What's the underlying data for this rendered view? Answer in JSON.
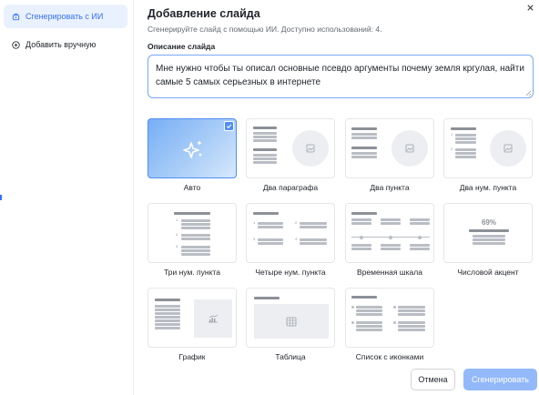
{
  "sidebar": {
    "items": [
      {
        "label": "Сгенерировать с ИИ",
        "icon": "magic-wand-icon",
        "active": true
      },
      {
        "label": "Добавить вручную",
        "icon": "plus-circle-icon",
        "active": false
      }
    ]
  },
  "dialog": {
    "title": "Добавление слайда",
    "subtitle": "Сгенерируйте слайд с помощью ИИ. Доступно использований: 4.",
    "field_label": "Описание слайда",
    "description_value": "Мне нужно чтобы ты описал основные псевдо аргументы почему земля кргулая, найти самые 5 самых серьезных в интернете"
  },
  "layouts": [
    {
      "label": "Авто",
      "selected": true,
      "icon": "sparkles-icon"
    },
    {
      "label": "Два параграфа",
      "selected": false
    },
    {
      "label": "Два пункта",
      "selected": false
    },
    {
      "label": "Два нум. пункта",
      "selected": false
    },
    {
      "label": "Три нум. пункта",
      "selected": false
    },
    {
      "label": "Четыре нум. пункта",
      "selected": false
    },
    {
      "label": "Временная шкала",
      "selected": false
    },
    {
      "label": "Числовой акцент",
      "selected": false,
      "accent_value": "69%"
    },
    {
      "label": "График",
      "selected": false
    },
    {
      "label": "Таблица",
      "selected": false
    },
    {
      "label": "Список с иконками",
      "selected": false
    }
  ],
  "buttons": {
    "cancel": "Отмена",
    "generate": "Сгенерировать"
  },
  "colors": {
    "accent": "#3370ff",
    "selected_border": "#4f8ef7",
    "generate_disabled": "#93b9fb"
  }
}
